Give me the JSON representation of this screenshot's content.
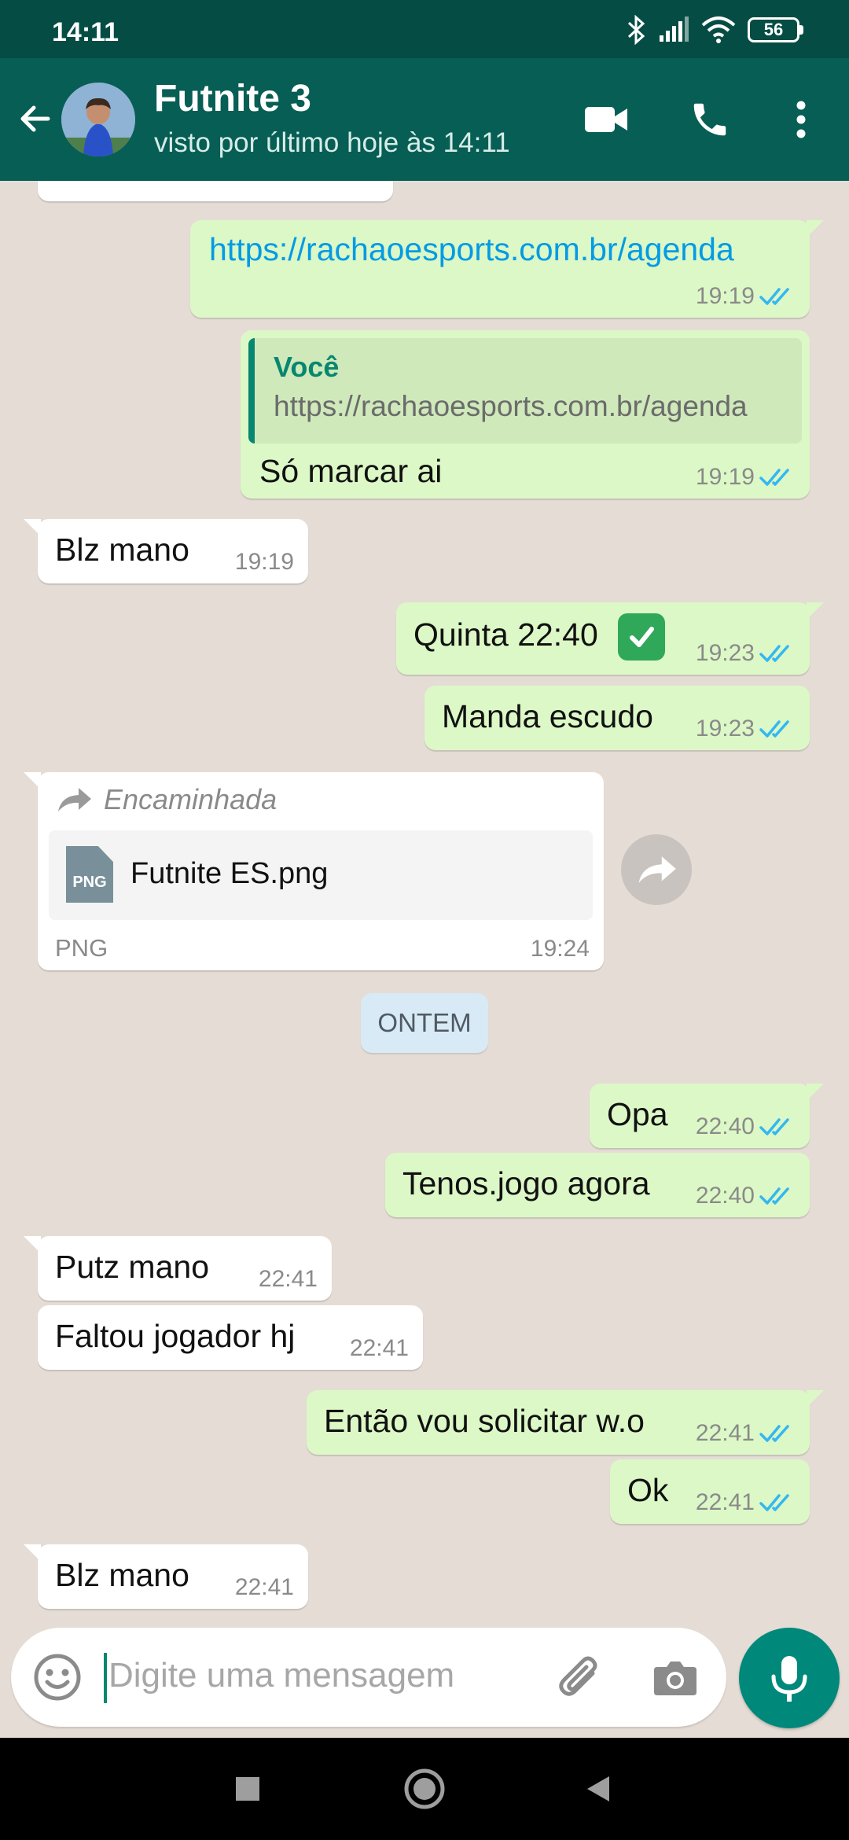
{
  "status_bar": {
    "time": "14:11",
    "battery": "56"
  },
  "header": {
    "title": "Futnite 3",
    "subtitle": "visto por último hoje às 14:11"
  },
  "colors": {
    "header": "#075e54",
    "status_bar": "#054d44",
    "outgoing_bubble": "#dcf8c6",
    "incoming_bubble": "#ffffff",
    "chat_background": "#e5ddd5",
    "read_ticks": "#34b7f1",
    "accent": "#00897b"
  },
  "messages": [
    {
      "direction": "outgoing",
      "text": "https://rachaoesports.com.br/agenda",
      "time": "19:19",
      "is_link": true
    },
    {
      "direction": "outgoing",
      "quote_author": "Você",
      "quote_text": "https://rachaoesports.com.br/agenda",
      "text": "Só marcar ai",
      "time": "19:19"
    },
    {
      "direction": "incoming",
      "text": "Blz mano",
      "time": "19:19"
    },
    {
      "direction": "outgoing",
      "text": "Quinta 22:40",
      "emoji": "✅",
      "time": "19:23"
    },
    {
      "direction": "outgoing",
      "text": "Manda escudo",
      "time": "19:23"
    },
    {
      "direction": "incoming",
      "forwarded_label": "Encaminhada",
      "file_name": "Futnite ES.png",
      "file_badge": "PNG",
      "file_type": "PNG",
      "time": "19:24"
    },
    {
      "direction": "outgoing",
      "text": "Opa",
      "time": "22:40"
    },
    {
      "direction": "outgoing",
      "text": "Tenos.jogo agora",
      "time": "22:40"
    },
    {
      "direction": "incoming",
      "text": "Putz mano",
      "time": "22:41"
    },
    {
      "direction": "incoming",
      "text": "Faltou jogador hj",
      "time": "22:41"
    },
    {
      "direction": "outgoing",
      "text": "Então vou solicitar w.o",
      "time": "22:41"
    },
    {
      "direction": "outgoing",
      "text": "Ok",
      "time": "22:41"
    },
    {
      "direction": "incoming",
      "text": "Blz mano",
      "time": "22:41"
    }
  ],
  "date_divider": "ONTEM",
  "composer": {
    "placeholder": "Digite uma mensagem"
  },
  "icons": {
    "header": [
      "back-arrow-icon",
      "video-call-icon",
      "voice-call-icon",
      "more-options-icon"
    ],
    "composer": [
      "emoji-icon",
      "attach-icon",
      "camera-icon",
      "mic-icon"
    ],
    "navigation": [
      "recents-icon",
      "home-icon",
      "back-icon"
    ]
  }
}
